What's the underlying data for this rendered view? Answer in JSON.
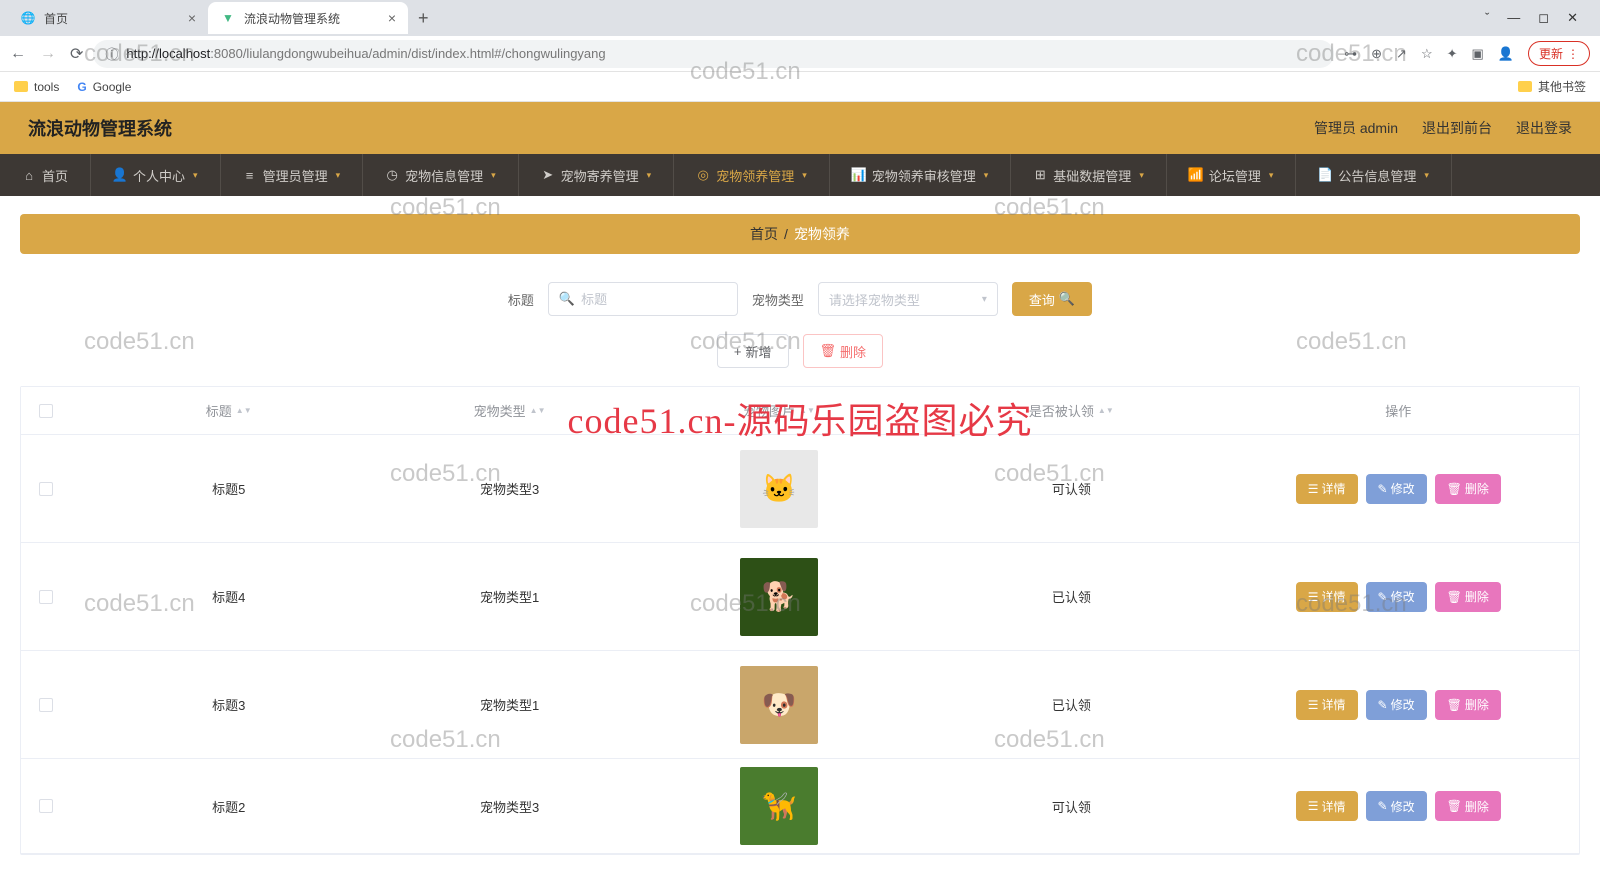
{
  "browser": {
    "tabs": [
      {
        "title": "首页",
        "active": false
      },
      {
        "title": "流浪动物管理系统",
        "active": true
      }
    ],
    "url_host": "localhost",
    "url_port": ":8080",
    "url_path": "/liulangdongwubeihua/admin/dist/index.html#/chongwulingyang",
    "url_prefix": "http://",
    "update_label": "更新",
    "bookmarks": {
      "tools": "tools",
      "google": "Google",
      "other": "其他书签"
    }
  },
  "app": {
    "title": "流浪动物管理系统",
    "user_label": "管理员 admin",
    "to_front": "退出到前台",
    "logout": "退出登录"
  },
  "nav": [
    {
      "label": "首页",
      "icon": "home",
      "caret": false
    },
    {
      "label": "个人中心",
      "icon": "user",
      "caret": true
    },
    {
      "label": "管理员管理",
      "icon": "list",
      "caret": true
    },
    {
      "label": "宠物信息管理",
      "icon": "clock",
      "caret": true
    },
    {
      "label": "宠物寄养管理",
      "icon": "send",
      "caret": true
    },
    {
      "label": "宠物领养管理",
      "icon": "target",
      "caret": true,
      "active": true
    },
    {
      "label": "宠物领养审核管理",
      "icon": "chart",
      "caret": true
    },
    {
      "label": "基础数据管理",
      "icon": "grid",
      "caret": true
    },
    {
      "label": "论坛管理",
      "icon": "bars",
      "caret": true
    },
    {
      "label": "公告信息管理",
      "icon": "doc",
      "caret": true
    }
  ],
  "breadcrumb": {
    "home": "首页",
    "current": "宠物领养"
  },
  "search": {
    "title_label": "标题",
    "title_placeholder": "标题",
    "type_label": "宠物类型",
    "type_placeholder": "请选择宠物类型",
    "query_btn": "查询"
  },
  "actions": {
    "add": "新增",
    "delete": "删除"
  },
  "table": {
    "headers": {
      "title": "标题",
      "type": "宠物类型",
      "img": "宠物图片",
      "status": "是否被认领",
      "ops": "操作"
    },
    "op_labels": {
      "detail": "详情",
      "edit": "修改",
      "delete": "删除"
    },
    "rows": [
      {
        "title": "标题5",
        "type": "宠物类型3",
        "img": "🐱",
        "imgbg": "#e8e8e8",
        "status": "可认领"
      },
      {
        "title": "标题4",
        "type": "宠物类型1",
        "img": "🐕",
        "imgbg": "#2d5016",
        "status": "已认领"
      },
      {
        "title": "标题3",
        "type": "宠物类型1",
        "img": "🐶",
        "imgbg": "#c9a66b",
        "status": "已认领"
      },
      {
        "title": "标题2",
        "type": "宠物类型3",
        "img": "🦮",
        "imgbg": "#4a7c2e",
        "status": "可认领"
      }
    ]
  },
  "watermarks": {
    "text": "code51.cn",
    "big": "code51.cn-源码乐园盗图必究"
  }
}
